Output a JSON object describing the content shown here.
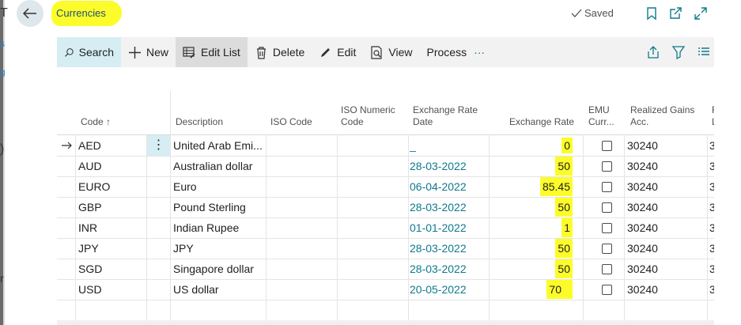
{
  "page": {
    "title": "Currencies",
    "saved_label": "Saved",
    "left_fragments": [
      "T",
      "s",
      "g",
      ")",
      "r"
    ]
  },
  "actions": {
    "search": "Search",
    "new": "New",
    "edit_list": "Edit List",
    "delete": "Delete",
    "edit": "Edit",
    "view": "View",
    "process": "Process",
    "more": "···"
  },
  "columns": {
    "code": "Code ↑",
    "description": "Description",
    "iso_code": "ISO Code",
    "iso_numeric_1": "ISO Numeric",
    "iso_numeric_2": "Code",
    "ex_date_1": "Exchange Rate",
    "ex_date_2": "Date",
    "ex_rate": "Exchange Rate",
    "emu_1": "EMU",
    "emu_2": "Curr...",
    "gains_1": "Realized Gains",
    "gains_2": "Acc.",
    "next_1": "R",
    "next_2": "L"
  },
  "row_menu_glyph": "⋮",
  "rows": [
    {
      "code": "AED",
      "description": "United Arab Emi...",
      "date": "_",
      "rate": "0",
      "gains": "30240",
      "next": "3",
      "emu": false
    },
    {
      "code": "AUD",
      "description": "Australian dollar",
      "date": "28-03-2022",
      "rate": "50",
      "gains": "30240",
      "next": "3",
      "emu": false
    },
    {
      "code": "EURO",
      "description": "Euro",
      "date": "06-04-2022",
      "rate": "85.45",
      "gains": "30240",
      "next": "3",
      "emu": false
    },
    {
      "code": "GBP",
      "description": "Pound Sterling",
      "date": "28-03-2022",
      "rate": "50",
      "gains": "30240",
      "next": "3",
      "emu": false
    },
    {
      "code": "INR",
      "description": "Indian Rupee",
      "date": "01-01-2022",
      "rate": "1",
      "gains": "30240",
      "next": "3",
      "emu": false
    },
    {
      "code": "JPY",
      "description": "JPY",
      "date": "28-03-2022",
      "rate": "50",
      "gains": "30240",
      "next": "3",
      "emu": false
    },
    {
      "code": "SGD",
      "description": "Singapore dollar",
      "date": "28-03-2022",
      "rate": "50",
      "gains": "30240",
      "next": "3",
      "emu": false
    },
    {
      "code": "USD",
      "description": "US dollar",
      "date": "20-05-2022",
      "rate": "70",
      "gains": "30240",
      "next": "3",
      "emu": false
    }
  ],
  "colors": {
    "highlight": "#fcfc2a",
    "date": "#0e7a8c",
    "accent": "#0e7a8c"
  }
}
